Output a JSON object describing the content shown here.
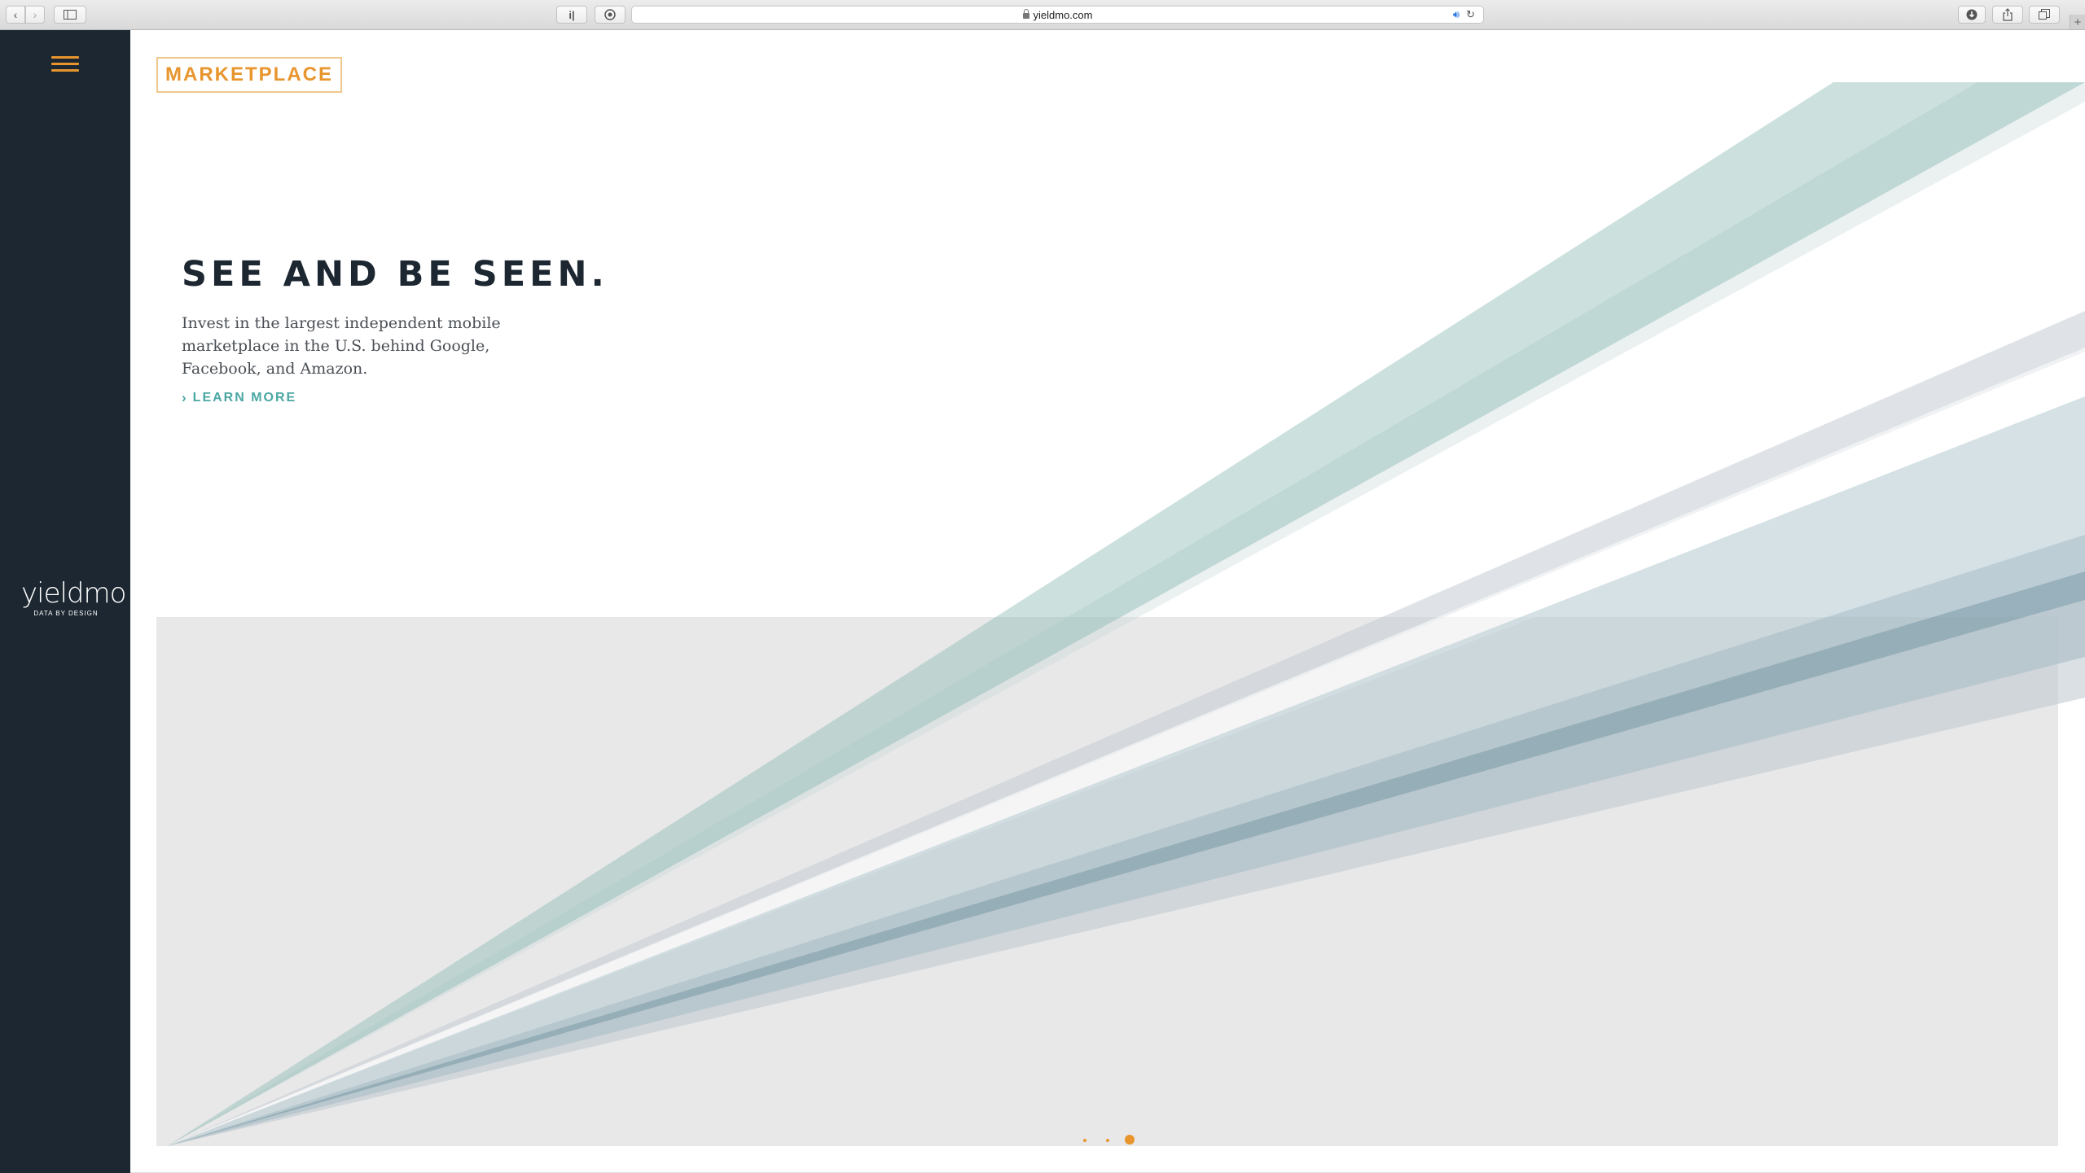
{
  "browser": {
    "url": "yieldmo.com",
    "reader_button": "i|",
    "new_tab": "+"
  },
  "sidebar": {
    "logo_text": "yieldmo",
    "logo_tagline": "DATA BY DESIGN"
  },
  "page": {
    "section_tag": "MARKETPLACE",
    "hero_title": "SEE AND BE SEEN.",
    "hero_body": "Invest in the largest independent mobile marketplace in the U.S. behind Google, Facebook, and Amazon.",
    "learn_more": "LEARN MORE",
    "carousel": {
      "slides": 3,
      "active_index": 3
    }
  },
  "colors": {
    "sidebar": "#1d2731",
    "accent_orange": "#e8952d",
    "teal_link": "#4aa7a2",
    "headline": "#1d2731",
    "panel_gray": "#e8e8e8"
  },
  "icons": [
    "back-icon",
    "forward-icon",
    "sidebar-toggle-icon",
    "lock-icon",
    "speaker-icon",
    "reload-icon",
    "download-icon",
    "share-icon",
    "tabs-icon",
    "hamburger-icon",
    "chevron-right-icon"
  ]
}
